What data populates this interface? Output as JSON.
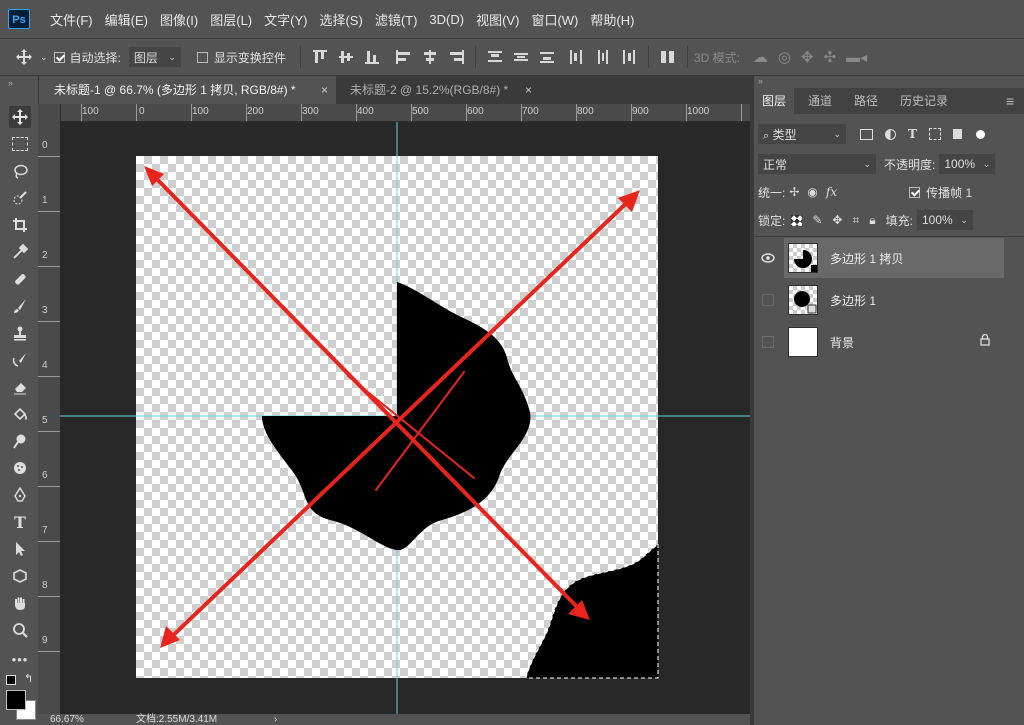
{
  "app": {
    "logo": "Ps"
  },
  "menu": [
    "文件(F)",
    "编辑(E)",
    "图像(I)",
    "图层(L)",
    "文字(Y)",
    "选择(S)",
    "滤镜(T)",
    "3D(D)",
    "视图(V)",
    "窗口(W)",
    "帮助(H)"
  ],
  "options": {
    "auto_select_label": "自动选择:",
    "auto_select_checked": true,
    "target_value": "图层",
    "show_transform_label": "显示变换控件",
    "show_transform_checked": false,
    "mode_3d_label": "3D 模式:"
  },
  "tabs": [
    {
      "label": "未标题-1 @ 66.7% (多边形 1 拷贝, RGB/8#) *",
      "close": "×"
    },
    {
      "label": "未标题-2 @ 15.2%(RGB/8#) *",
      "close": "×"
    }
  ],
  "ruler": {
    "h_labels": [
      "100",
      "0",
      "100",
      "200",
      "300",
      "400",
      "500",
      "600",
      "700",
      "800",
      "900",
      "1000"
    ],
    "v_labels": [
      "0",
      "1",
      "2",
      "3",
      "4",
      "5",
      "6",
      "7",
      "8",
      "9"
    ]
  },
  "status": {
    "zoom": "66.67%",
    "doc_info": "文档:2.55M/3.41M",
    "arrow": "›"
  },
  "panel": {
    "tabs": [
      "图层",
      "通道",
      "路径",
      "历史记录"
    ],
    "menu_icon": "≡",
    "filter_label": "类型",
    "filter_icon": "search-icon",
    "blend_mode": "正常",
    "opacity_label": "不透明度:",
    "opacity_value": "100%",
    "unify_label": "统一:",
    "propagate_label": "传播帧 1",
    "lock_label": "锁定:",
    "fill_label": "填充:",
    "fill_value": "100%",
    "layers": [
      {
        "name": "多边形 1 拷贝",
        "visible": true,
        "selected": true
      },
      {
        "name": "多边形 1",
        "visible": false,
        "selected": false
      },
      {
        "name": "背景",
        "visible": false,
        "selected": false,
        "locked": true
      }
    ]
  },
  "colors": {
    "accent": "#31a8ff",
    "guide": "#5fd3e6",
    "arrow": "#e8241c"
  }
}
